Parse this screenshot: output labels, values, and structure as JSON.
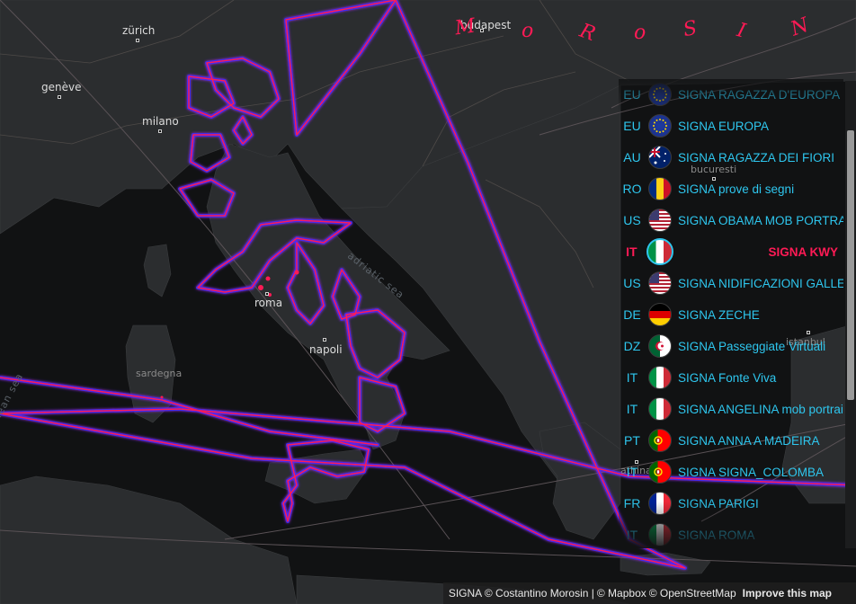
{
  "title_letters": [
    "M",
    "o",
    "R",
    "o",
    "S",
    "I",
    "N"
  ],
  "cities": [
    {
      "name": "zürich",
      "key": "zurich"
    },
    {
      "name": "genève",
      "key": "geneve"
    },
    {
      "name": "milano",
      "key": "milano"
    },
    {
      "name": "budapest",
      "key": "budapest"
    },
    {
      "name": "bucuresti",
      "key": "bucuresti"
    },
    {
      "name": "roma",
      "key": "roma"
    },
    {
      "name": "napoli",
      "key": "napoli"
    },
    {
      "name": "sardegna",
      "key": "sardegna"
    },
    {
      "name": "istanbul",
      "key": "istanbul"
    },
    {
      "name": "athina",
      "key": "athina"
    }
  ],
  "seas": {
    "adriatic": "adriatic sea",
    "mediterranean": "mediterranean sea"
  },
  "list": [
    {
      "cc": "EU",
      "flag": "eu",
      "name": "SIGNA RAGAZZA D'EUROPA",
      "active": false
    },
    {
      "cc": "EU",
      "flag": "eu",
      "name": "SIGNA EUROPA",
      "active": false
    },
    {
      "cc": "AU",
      "flag": "au",
      "name": "SIGNA RAGAZZA DEI FIORI",
      "active": false
    },
    {
      "cc": "RO",
      "flag": "ro",
      "name": "SIGNA prove di segni",
      "active": false
    },
    {
      "cc": "US",
      "flag": "us",
      "name": "SIGNA OBAMA MOB PORTRA",
      "active": false
    },
    {
      "cc": "IT",
      "flag": "it",
      "name": "SIGNA KWY",
      "active": true
    },
    {
      "cc": "US",
      "flag": "us",
      "name": "SIGNA NIDIFICAZIONI GALLEI",
      "active": false
    },
    {
      "cc": "DE",
      "flag": "de",
      "name": "SIGNA ZECHE",
      "active": false
    },
    {
      "cc": "DZ",
      "flag": "dz",
      "name": "SIGNA Passeggiate Virtuali",
      "active": false
    },
    {
      "cc": "IT",
      "flag": "it",
      "name": "SIGNA Fonte Viva",
      "active": false
    },
    {
      "cc": "IT",
      "flag": "it",
      "name": "SIGNA ANGELINA mob portrait",
      "active": false
    },
    {
      "cc": "PT",
      "flag": "pt",
      "name": "SIGNA ANNA A MADEIRA",
      "active": false
    },
    {
      "cc": "IT",
      "flag": "pt",
      "name": "SIGNA SIGNA_COLOMBA",
      "active": false
    },
    {
      "cc": "FR",
      "flag": "fr",
      "name": "SIGNA PARIGI",
      "active": false
    },
    {
      "cc": "IT",
      "flag": "it",
      "name": "SIGNA ROMA",
      "active": false
    }
  ],
  "attribution": {
    "signa": "SIGNA © Costantino Morosin |",
    "mapbox": "© Mapbox",
    "osm": "© OpenStreetMap",
    "improve": "Improve this map"
  },
  "colors": {
    "sea": "#111213",
    "land": "#2b2d2f",
    "trace": "#ff1a55",
    "trace_glow": "#2a2cff",
    "accent": "#2ec6ee"
  }
}
